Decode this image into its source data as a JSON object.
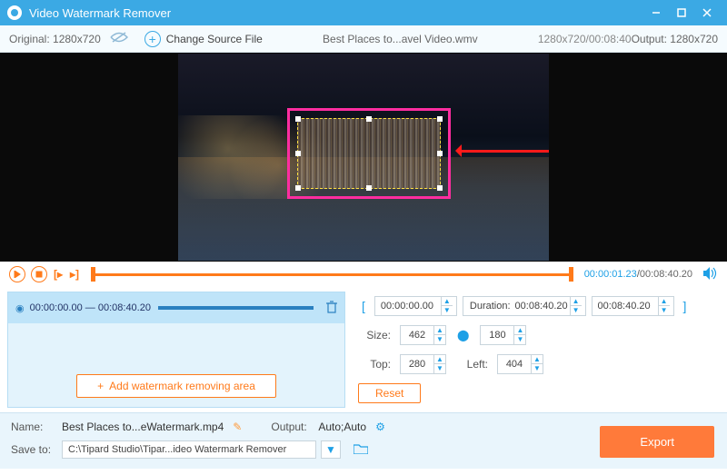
{
  "titlebar": {
    "title": "Video Watermark Remover"
  },
  "toolbar": {
    "original_label": "Original:",
    "original_dims": "1280x720",
    "change_label": "Change Source File",
    "filename": "Best Places to...avel Video.wmv",
    "file_dims": "1280x720/00:08:40",
    "output_label": "Output:",
    "output_dims": "1280x720"
  },
  "playback": {
    "current": "00:00:01.23",
    "total": "00:08:40.20"
  },
  "segment": {
    "start": "00:00:00.00",
    "sep": "—",
    "end": "00:08:40.20",
    "add_label": "Add watermark removing area"
  },
  "controls": {
    "range_start": "00:00:00.00",
    "duration_label": "Duration:",
    "duration": "00:08:40.20",
    "range_end": "00:08:40.20",
    "size_label": "Size:",
    "size_w": "462",
    "size_h": "180",
    "top_label": "Top:",
    "top": "280",
    "left_label": "Left:",
    "left": "404",
    "reset": "Reset"
  },
  "bottom": {
    "name_label": "Name:",
    "name_value": "Best Places to...eWatermark.mp4",
    "output_label": "Output:",
    "output_value": "Auto;Auto",
    "save_label": "Save to:",
    "save_path": "C:\\Tipard Studio\\Tipar...ideo Watermark Remover",
    "export": "Export"
  }
}
